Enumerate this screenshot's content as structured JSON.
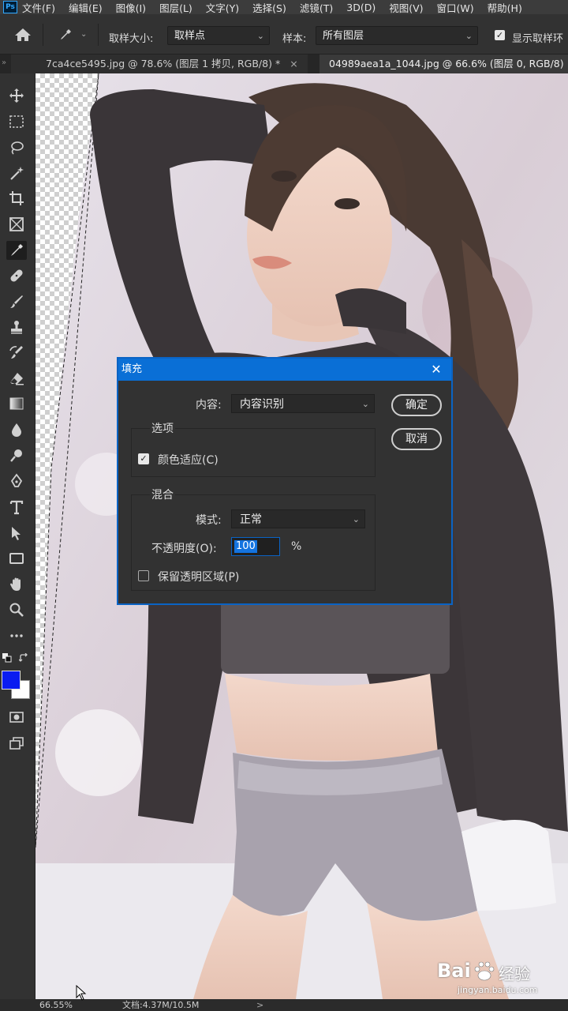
{
  "menu": {
    "logo": "Ps",
    "items": [
      "文件(F)",
      "编辑(E)",
      "图像(I)",
      "图层(L)",
      "文字(Y)",
      "选择(S)",
      "滤镜(T)",
      "3D(D)",
      "视图(V)",
      "窗口(W)",
      "帮助(H)"
    ]
  },
  "options": {
    "sample_size_label": "取样大小:",
    "sample_size_value": "取样点",
    "sample_label": "样本:",
    "sample_value": "所有图层",
    "show_ring_label": "显示取样环",
    "show_ring_checked": true
  },
  "tabs": [
    {
      "label": "7ca4ce5495.jpg @ 78.6% (图层 1 拷贝, RGB/8) *",
      "close": "×",
      "active": false
    },
    {
      "label": "04989aea1a_1044.jpg @ 66.6% (图层 0, RGB/8)",
      "active": true
    }
  ],
  "tools": [
    "move-tool",
    "marquee-tool",
    "lasso-tool",
    "magic-wand-tool",
    "crop-tool",
    "frame-tool",
    "eyedropper-tool",
    "healing-tool",
    "brush-tool",
    "stamp-tool",
    "history-brush-tool",
    "eraser-tool",
    "gradient-tool",
    "blur-tool",
    "dodge-tool",
    "pen-tool",
    "type-tool",
    "path-select-tool",
    "shape-tool",
    "hand-tool",
    "zoom-tool",
    "more-tools"
  ],
  "colors": {
    "foreground": "#0a1cf0",
    "background": "#ffffff",
    "accent": "#0a6fd6"
  },
  "dialog": {
    "title": "填充",
    "close": "✕",
    "contents_label": "内容:",
    "contents_value": "内容识别",
    "options_group": "选项",
    "color_adapt_label": "颜色适应(C)",
    "color_adapt_checked": true,
    "blend_group": "混合",
    "mode_label": "模式:",
    "mode_value": "正常",
    "opacity_label": "不透明度(O):",
    "opacity_value": "100",
    "opacity_unit": "%",
    "preserve_label": "保留透明区域(P)",
    "preserve_checked": false,
    "ok_label": "确定",
    "cancel_label": "取消"
  },
  "status": {
    "zoom": "66.55%",
    "doc": "文档:4.37M/10.5M",
    "arrow": ">"
  },
  "watermark": {
    "brand": "Bai",
    "brand2": "经验",
    "url": "jingyan.baidu.com"
  }
}
